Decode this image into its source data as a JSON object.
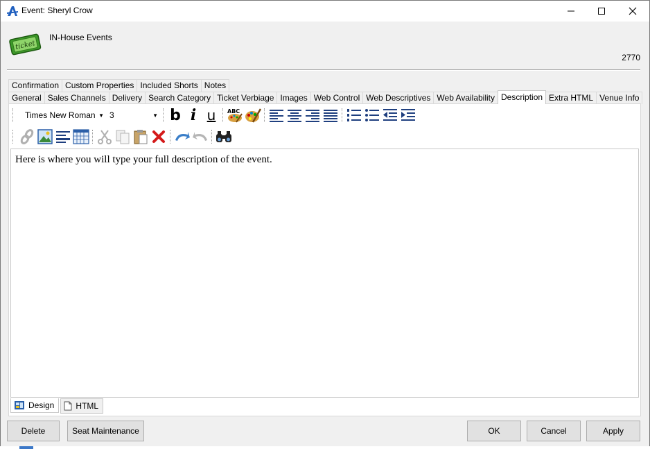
{
  "window": {
    "title": "Event: Sheryl Crow",
    "app_icon": "app-logo-icon",
    "controls": [
      "minimize-icon",
      "maximize-icon",
      "close-icon"
    ]
  },
  "header": {
    "logo_icon": "ticket-icon",
    "logo_text": "ticket",
    "organization": "IN-House Events",
    "event_id": "2770"
  },
  "tabs_row1": [
    {
      "label": "Confirmation"
    },
    {
      "label": "Custom Properties"
    },
    {
      "label": "Included Shorts"
    },
    {
      "label": "Notes"
    }
  ],
  "tabs_row2": [
    {
      "label": "General"
    },
    {
      "label": "Sales Channels"
    },
    {
      "label": "Delivery"
    },
    {
      "label": "Search Category"
    },
    {
      "label": "Ticket Verbiage"
    },
    {
      "label": "Images"
    },
    {
      "label": "Web Control"
    },
    {
      "label": "Web Descriptives"
    },
    {
      "label": "Web Availability"
    },
    {
      "label": "Description",
      "active": true
    },
    {
      "label": "Extra HTML"
    },
    {
      "label": "Venue Info"
    }
  ],
  "editor": {
    "font_family": "Times New Roman",
    "font_size": "3",
    "content": "Here is where you will type your full description of the event."
  },
  "toolbar1_icons": [
    "bold-icon",
    "italic-icon",
    "underline-icon",
    "spellcheck-icon",
    "color-palette-icon",
    "align-left-icon",
    "align-center-icon",
    "align-right-icon",
    "justify-icon",
    "numbered-list-icon",
    "bullet-list-icon",
    "outdent-icon",
    "indent-icon"
  ],
  "toolbar2_icons": [
    "link-icon",
    "insert-image-icon",
    "horizontal-rule-icon",
    "insert-table-icon",
    "cut-icon",
    "copy-icon",
    "paste-icon",
    "delete-icon",
    "undo-icon",
    "redo-icon",
    "find-icon"
  ],
  "mode_tabs": {
    "design": "Design",
    "html": "HTML"
  },
  "buttons": {
    "delete": "Delete",
    "seat_maintenance": "Seat Maintenance",
    "ok": "OK",
    "cancel": "Cancel",
    "apply": "Apply"
  }
}
